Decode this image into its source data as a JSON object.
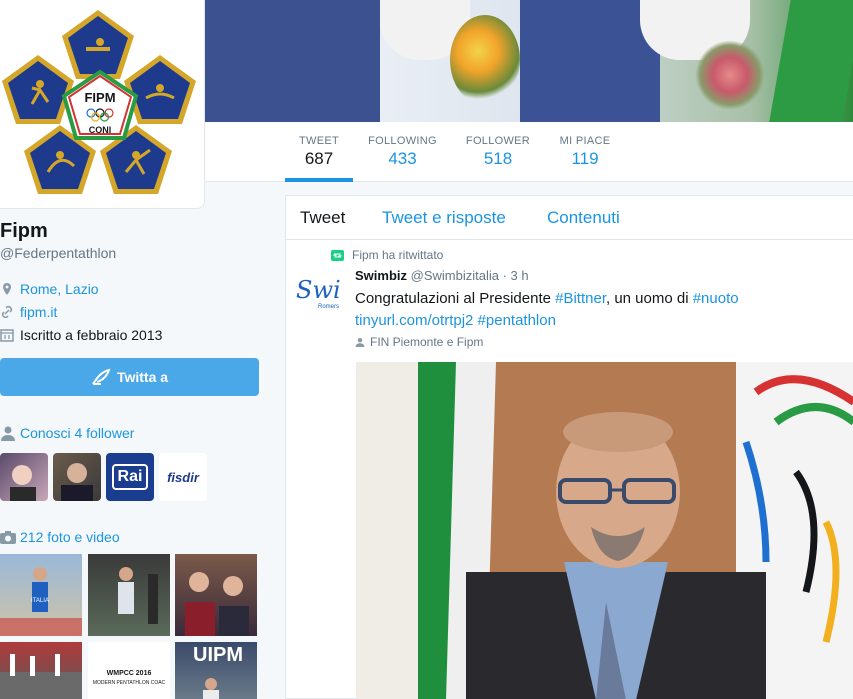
{
  "profile": {
    "name": "Fipm",
    "handle": "@Federpentathlon",
    "location": "Rome, Lazio",
    "website": "fipm.it",
    "joined": "Iscritto a febbraio 2013",
    "logo_text_1": "FIPM",
    "logo_text_2": "CONI"
  },
  "stats": [
    {
      "label": "TWEET",
      "value": "687"
    },
    {
      "label": "FOLLOWING",
      "value": "433"
    },
    {
      "label": "FOLLOWER",
      "value": "518"
    },
    {
      "label": "MI PIACE",
      "value": "119"
    }
  ],
  "actions": {
    "tweet_to": "Twitta a",
    "known_followers": "Conosci 4 follower",
    "photos_videos": "212 foto e video"
  },
  "follower_thumbs": {
    "rai": "Rai",
    "fisdir": "fisdir"
  },
  "media_thumbs": {
    "wmpcc_line1": "WMPCC 2016",
    "wmpcc_line2": "MODERN PENTATHLON COAC",
    "uipm": "UIPM",
    "italia": "ITALIA"
  },
  "tabs": [
    "Tweet",
    "Tweet e risposte",
    "Contenuti"
  ],
  "tweet": {
    "retweet_label": "Fipm ha ritwittato",
    "author": "Swimbiz",
    "author_handle": "@Swimbizitalia",
    "time": "· 3 h",
    "text_1": "Congratulazioni al Presidente ",
    "hashtag_1": "#Bittner",
    "text_2": ", un uomo di ",
    "hashtag_2": "#nuoto",
    "link": "tinyurl.com/otrtpj2",
    "hashtag_3": "#pentathlon",
    "tagged": "FIN Piemonte e Fipm",
    "avatar_text": "Swi",
    "avatar_sub": "Romers"
  },
  "colors": {
    "accent": "#1b95e0",
    "tweet_button": "#4aa8e8",
    "retweet": "#19cf86",
    "logo_blue": "#1e3a8c",
    "logo_gold": "#d4a62a"
  },
  "icons": {
    "location": "map-pin-icon",
    "website": "link-icon",
    "joined": "calendar-icon",
    "tweet_btn": "quill-icon",
    "followers": "person-icon",
    "photos": "camera-icon",
    "retweet": "retweet-icon",
    "tagged": "person-icon"
  }
}
